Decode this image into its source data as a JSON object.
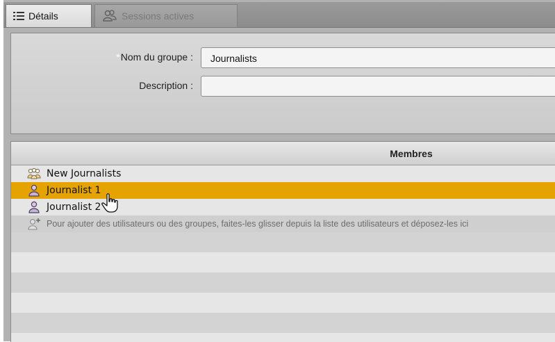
{
  "tabs": [
    {
      "label": "Détails",
      "icon": "list-icon",
      "active": true
    },
    {
      "label": "Sessions actives",
      "icon": "users-icon",
      "active": false
    }
  ],
  "form": {
    "required_marker": "*",
    "group_name_label": "Nom du groupe :",
    "group_name_value": "Journalists",
    "description_label": "Description :",
    "description_value": ""
  },
  "members": {
    "header": "Membres",
    "items": [
      {
        "label": "New Journalists",
        "icon": "group-icon",
        "selected": false
      },
      {
        "label": "Journalist 1",
        "icon": "user-icon",
        "selected": true
      },
      {
        "label": "Journalist 2",
        "icon": "user-icon",
        "selected": false
      }
    ],
    "hint": "Pour ajouter des utilisateurs ou des groupes, faites-les glisser depuis la liste des utilisateurs et déposez-les ici"
  },
  "colors": {
    "selection": "#e4a300",
    "panel": "#d6d6d6",
    "frame": "#b2b2b2"
  }
}
